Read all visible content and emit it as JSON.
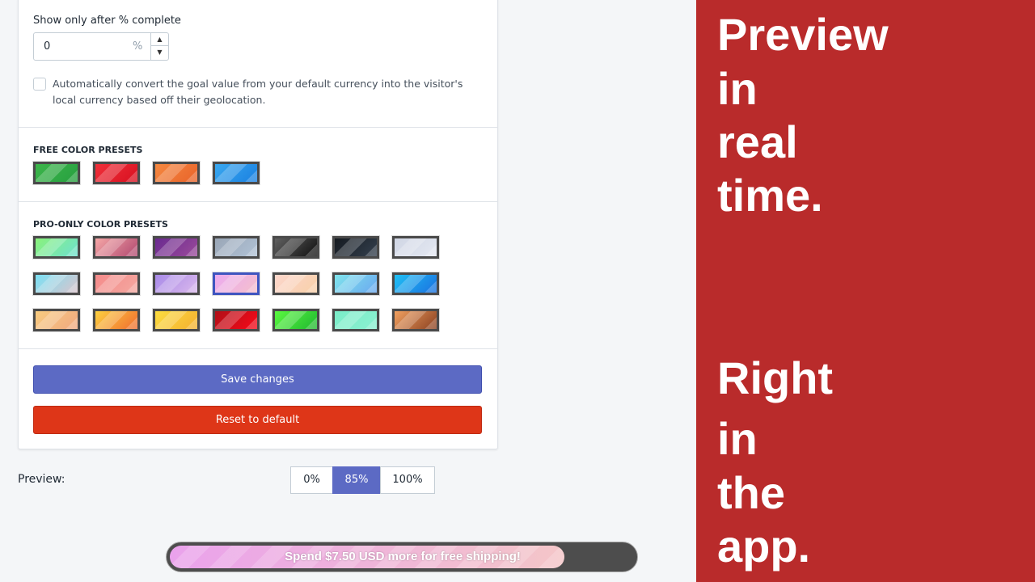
{
  "settings": {
    "show_after_label": "Show only after % complete",
    "show_after_value": "0",
    "percent_suffix": "%",
    "convert_checked": false,
    "convert_label": "Automatically convert the goal value from your default currency into the visitor's local currency based off their geolocation."
  },
  "free_presets": {
    "title": "FREE COLOR PRESETS",
    "swatches": [
      [
        "#3cb54a",
        "#27a040"
      ],
      [
        "#f0303a",
        "#d81020"
      ],
      [
        "#f58840",
        "#e8632a"
      ],
      [
        "#3aa8f0",
        "#1a80e0"
      ]
    ]
  },
  "pro_presets": {
    "title": "PRO-ONLY COLOR PRESETS",
    "selected": 10,
    "swatches": [
      [
        "#8af27a",
        "#6ee0d0"
      ],
      [
        "#f5a6a6",
        "#b04870"
      ],
      [
        "#6a2a90",
        "#9a4a9a"
      ],
      [
        "#9aa6b6",
        "#b0c2d6"
      ],
      [
        "#606060",
        "#101010"
      ],
      [
        "#151a20",
        "#34404e"
      ],
      [
        "#d0d6e4",
        "#e4e8f2"
      ],
      [
        "#7ae0f4",
        "#dac4cc"
      ],
      [
        "#f58a8a",
        "#f4a8a0"
      ],
      [
        "#a88ae8",
        "#dab8ec"
      ],
      [
        "#ecaaf0",
        "#f4c0cc"
      ],
      [
        "#fcd6cc",
        "#f8d0a8"
      ],
      [
        "#80e4ec",
        "#6aa8f0"
      ],
      [
        "#20c0f4",
        "#1a70e0"
      ],
      [
        "#f8cc80",
        "#f0a880"
      ],
      [
        "#fcd040",
        "#f06c30"
      ],
      [
        "#fcdc40",
        "#f4b030"
      ],
      [
        "#b01018",
        "#f80818"
      ],
      [
        "#5af840",
        "#20b830"
      ],
      [
        "#7aecc8",
        "#8af0d0"
      ],
      [
        "#f0a060",
        "#8a4020"
      ]
    ]
  },
  "buttons": {
    "save": "Save changes",
    "reset": "Reset to default"
  },
  "preview": {
    "label": "Preview:",
    "options": [
      "0%",
      "85%",
      "100%"
    ],
    "selected": "85%"
  },
  "progress_bar": {
    "message": "Spend $7.50 USD more for free shipping!",
    "progress_percent": 85,
    "colors": [
      "#eaa2ec",
      "#f4c6c8"
    ]
  },
  "promo": {
    "lines": [
      "Preview",
      "in",
      "real",
      "time.",
      "Right",
      "in",
      "the",
      "app."
    ],
    "background": "#b92b2b"
  }
}
